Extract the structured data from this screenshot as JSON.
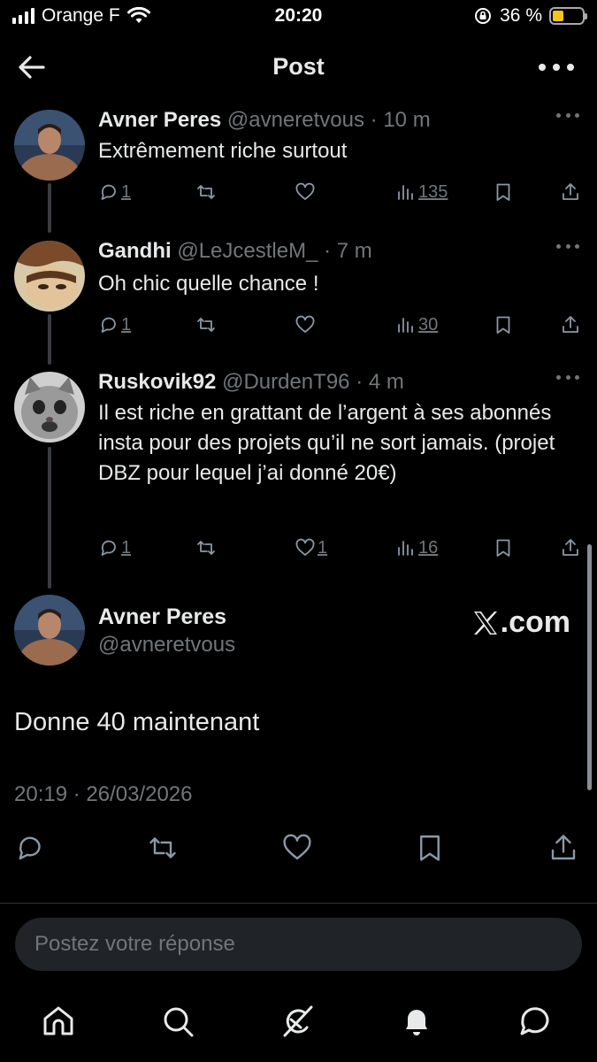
{
  "status_bar": {
    "carrier": "Orange F",
    "time": "20:20",
    "battery_percent": "36 %",
    "battery_level": 0.36,
    "battery_color": "#f5c518"
  },
  "header": {
    "title": "Post",
    "back_icon": "arrow-left-icon",
    "more_icon": "more-horizontal-icon"
  },
  "replies": [
    {
      "name": "Avner Peres",
      "handle": "@avneretvous",
      "dot": "·",
      "time": "10 m",
      "text": "Extrêmement riche surtout",
      "replies": "1",
      "reposts": "",
      "likes": "",
      "views": "135"
    },
    {
      "name": "Gandhi",
      "handle": "@LeJcestleM_",
      "dot": "·",
      "time": "7 m",
      "text": "Oh chic quelle chance !",
      "replies": "1",
      "reposts": "",
      "likes": "",
      "views": "30"
    },
    {
      "name": "Ruskovik92",
      "handle": "@DurdenT96",
      "dot": "·",
      "time": "4 m",
      "text": "Il est riche en grattant de l’argent à ses abonnés insta pour des projets qu’il ne sort jamais. (projet DBZ pour lequel j’ai donné 20€)",
      "replies": "1",
      "reposts": "",
      "likes": "1",
      "views": "16"
    }
  ],
  "main_post": {
    "name": "Avner Peres",
    "handle": "@avneretvous",
    "watermark": ".com",
    "text": "Donne 40 maintenant",
    "timestamp": "20:19 · 26/03/2026"
  },
  "reply_box": {
    "placeholder": "Postez votre réponse"
  },
  "colors": {
    "background": "#000000",
    "text": "#e7e9ea",
    "secondary": "#71767b",
    "input_bg": "#202327"
  }
}
